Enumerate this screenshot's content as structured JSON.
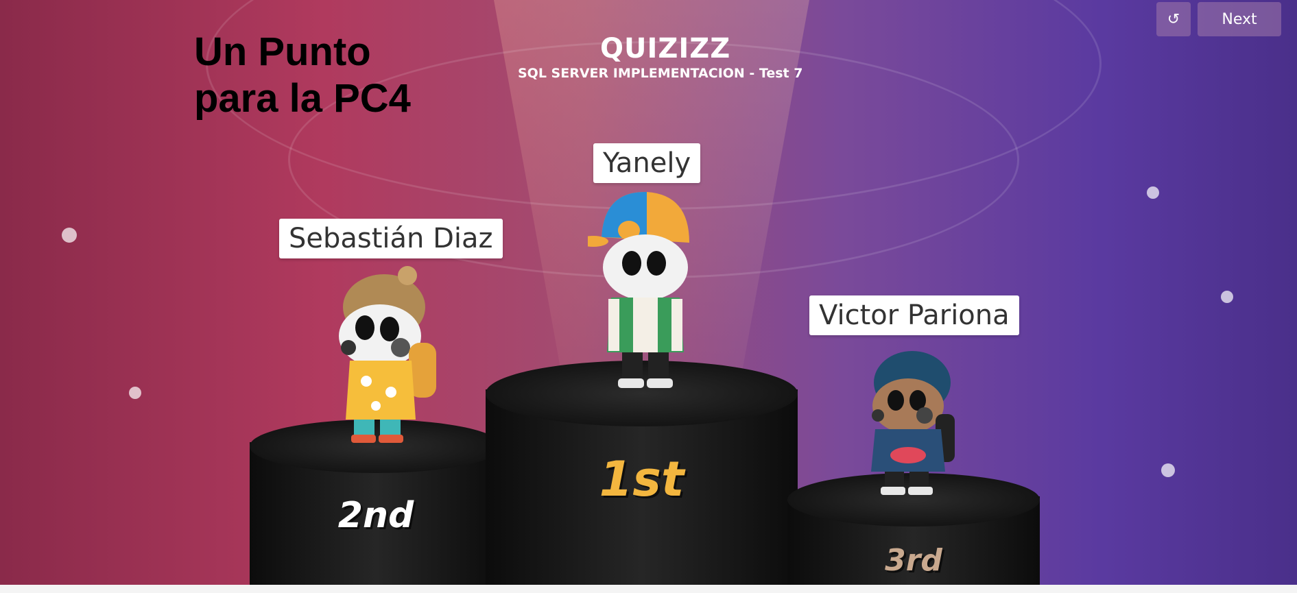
{
  "header": {
    "heading_line1": "Un Punto",
    "heading_line2": "para la PC4",
    "brand": "QUIZIZZ",
    "quiz_title": "SQL SERVER IMPLEMENTACION - Test 7"
  },
  "controls": {
    "restart_icon": "restart-icon",
    "next_label": "Next"
  },
  "podium": [
    {
      "place": 1,
      "name": "Yanely",
      "rank_label": "1st",
      "rank_color": "#f3b63f"
    },
    {
      "place": 2,
      "name": "Sebastián Diaz",
      "rank_label": "2nd",
      "rank_color": "#ffffff"
    },
    {
      "place": 3,
      "name": "Victor Pariona",
      "rank_label": "3rd",
      "rank_color": "#c9a98f"
    }
  ]
}
